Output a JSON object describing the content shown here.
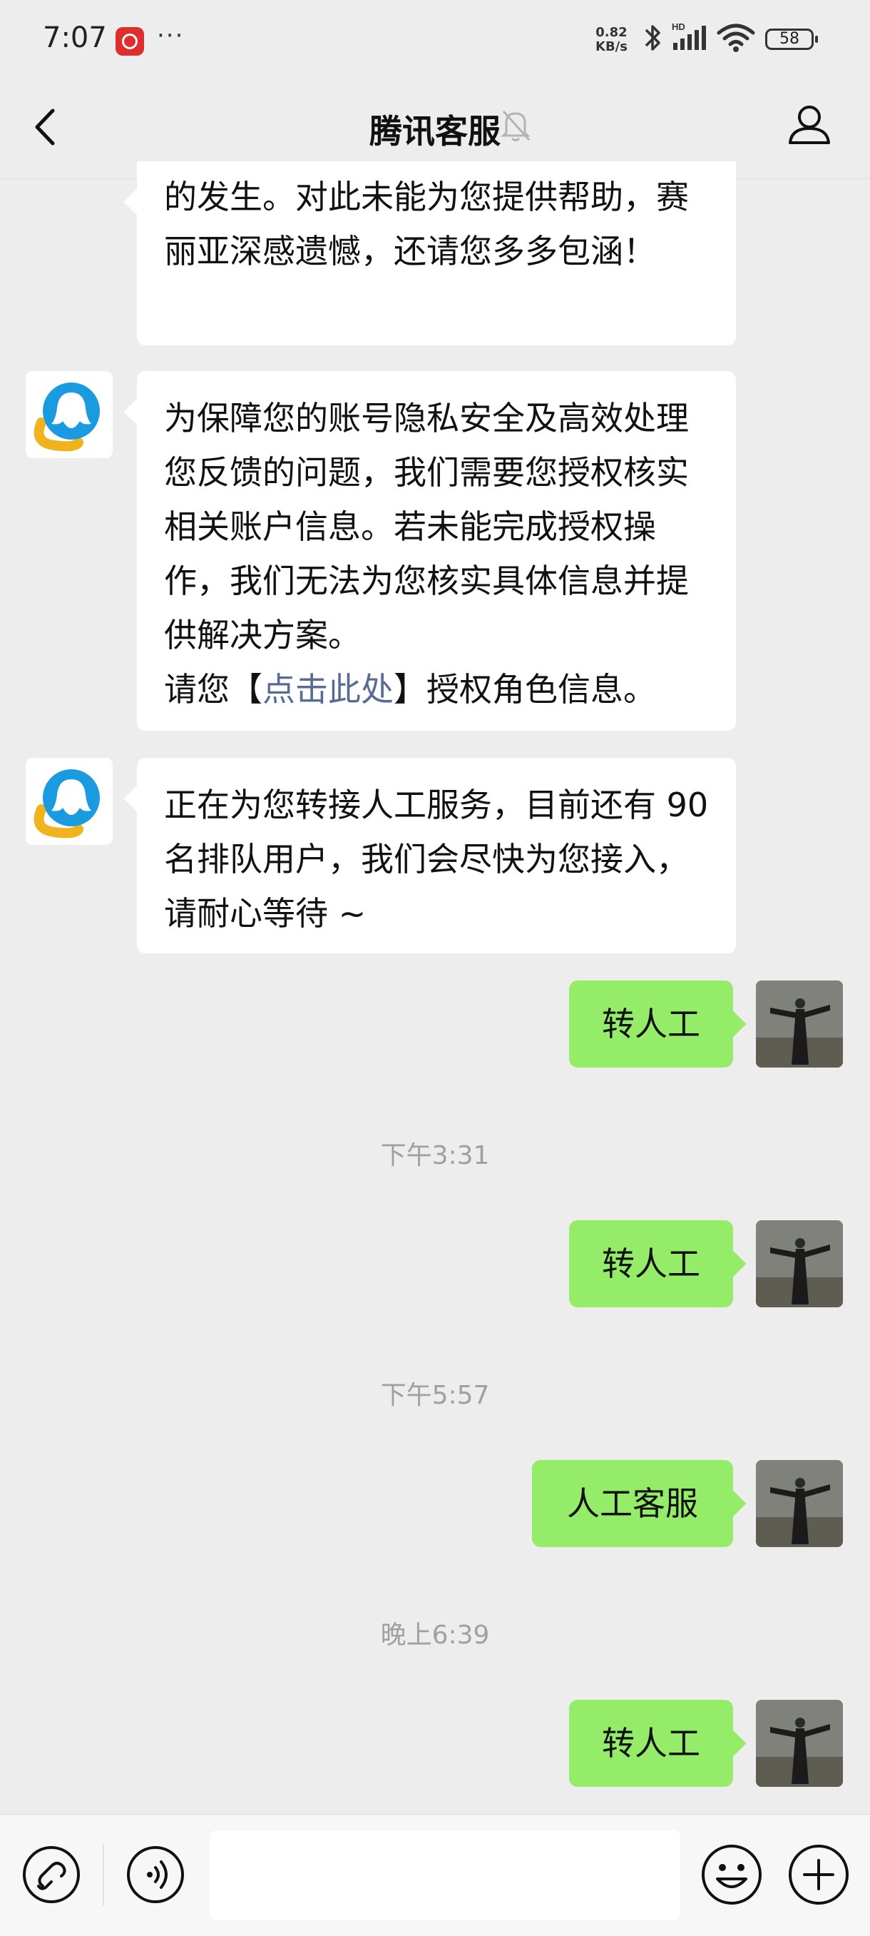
{
  "status_bar": {
    "time": "7:07",
    "more": "···",
    "net_speed_value": "0.82",
    "net_speed_unit": "KB/s",
    "network_badge": "HD",
    "battery": "58"
  },
  "nav": {
    "title": "腾讯客服"
  },
  "messages": {
    "m1_text": "的发生。对此未能为您提供帮助，赛丽亚深感遗憾，还请您多多包涵！",
    "m2_text_before": "为保障您的账号隐私安全及高效处理您反馈的问题，我们需要您授权核实相关账户信息。若未能完成授权操作，我们无法为您核实具体信息并提供解决方案。",
    "m2_text_prompt": "请您【",
    "m2_link": "点击此处",
    "m2_text_after": "】授权角色信息。",
    "m3_text": "正在为您转接人工服务，目前还有 90 名排队用户，我们会尽快为您接入，请耐心等待 ~",
    "m4_text": "转人工",
    "ts1": "下午3:31",
    "m5_text": "转人工",
    "ts2": "下午5:57",
    "m6_text": "人工客服",
    "ts3": "晚上6:39",
    "m7_text": "转人工"
  },
  "input_bar": {
    "placeholder": ""
  },
  "colors": {
    "background": "#ededed",
    "outgoing_bubble": "#95ec69",
    "incoming_bubble": "#ffffff",
    "link": "#576b95",
    "timestamp": "#a0a0a0"
  },
  "icons": {
    "back": "chevron-left-icon",
    "mute": "bell-off-icon",
    "profile": "person-icon",
    "bot_avatar": "qq-support-avatar",
    "mini_program": "mini-program-icon",
    "voice": "voice-icon",
    "emoji": "smiley-icon",
    "plus": "plus-icon"
  }
}
